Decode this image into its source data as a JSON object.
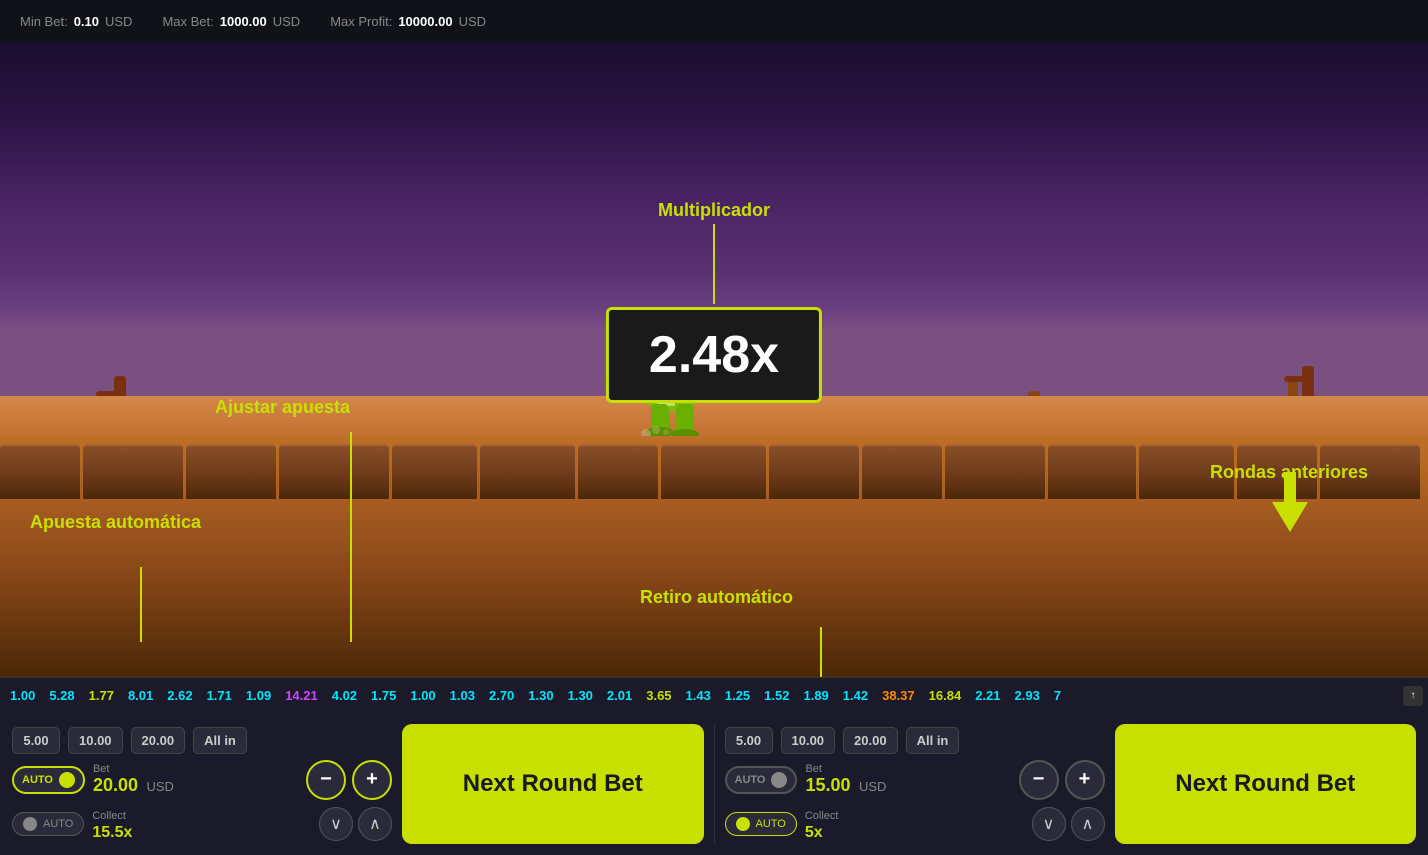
{
  "topbar": {
    "min_bet_label": "Min Bet:",
    "min_bet_value": "0.10",
    "min_bet_currency": "USD",
    "max_bet_label": "Max Bet:",
    "max_bet_value": "1000.00",
    "max_bet_currency": "USD",
    "max_profit_label": "Max Profit:",
    "max_profit_value": "10000.00",
    "max_profit_currency": "USD"
  },
  "game": {
    "multiplier": "2.48x",
    "multiplier_label": "Multiplicador"
  },
  "annotations": {
    "apuesta_automatica": "Apuesta automática",
    "ajustar_apuesta": "Ajustar apuesta",
    "multiplicador": "Multiplicador",
    "retiro_automatico": "Retiro automático",
    "rondas_anteriores": "Rondas anteriores"
  },
  "rounds": [
    {
      "value": "1.00",
      "color": "cyan"
    },
    {
      "value": "5.28",
      "color": "cyan"
    },
    {
      "value": "1.77",
      "color": "yellow"
    },
    {
      "value": "8.01",
      "color": "cyan"
    },
    {
      "value": "2.62",
      "color": "cyan"
    },
    {
      "value": "1.71",
      "color": "cyan"
    },
    {
      "value": "1.09",
      "color": "cyan"
    },
    {
      "value": "14.21",
      "color": "purple"
    },
    {
      "value": "4.02",
      "color": "cyan"
    },
    {
      "value": "1.75",
      "color": "cyan"
    },
    {
      "value": "1.00",
      "color": "cyan"
    },
    {
      "value": "1.03",
      "color": "cyan"
    },
    {
      "value": "2.70",
      "color": "cyan"
    },
    {
      "value": "1.30",
      "color": "cyan"
    },
    {
      "value": "1.30",
      "color": "cyan"
    },
    {
      "value": "2.01",
      "color": "cyan"
    },
    {
      "value": "3.65",
      "color": "yellow"
    },
    {
      "value": "1.43",
      "color": "cyan"
    },
    {
      "value": "1.25",
      "color": "cyan"
    },
    {
      "value": "1.52",
      "color": "cyan"
    },
    {
      "value": "1.89",
      "color": "cyan"
    },
    {
      "value": "1.42",
      "color": "cyan"
    },
    {
      "value": "38.37",
      "color": "orange"
    },
    {
      "value": "16.84",
      "color": "yellow"
    },
    {
      "value": "2.21",
      "color": "cyan"
    },
    {
      "value": "2.93",
      "color": "cyan"
    },
    {
      "value": "7",
      "color": "cyan"
    }
  ],
  "panel1": {
    "quick_bets": [
      "5.00",
      "10.00",
      "20.00",
      "All in"
    ],
    "auto_label": "AUTO",
    "bet_label": "Bet",
    "bet_value": "20.00",
    "bet_currency": "USD",
    "collect_label": "Collect",
    "collect_value": "15.5x",
    "auto_collect_label": "AUTO",
    "next_round_label": "Next Round Bet"
  },
  "panel2": {
    "quick_bets": [
      "5.00",
      "10.00",
      "20.00",
      "All in"
    ],
    "auto_label": "AUTO",
    "bet_label": "Bet",
    "bet_value": "15.00",
    "bet_currency": "USD",
    "collect_label": "Collect",
    "collect_value": "5x",
    "auto_collect_label": "AUTO",
    "next_round_label": "Next Round Bet"
  }
}
